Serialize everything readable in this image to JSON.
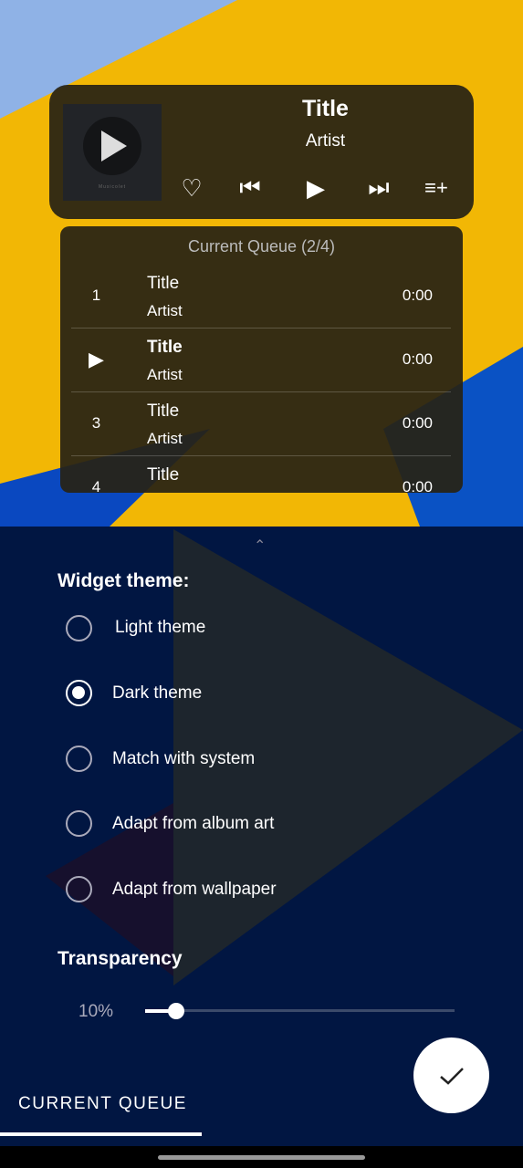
{
  "widget": {
    "album_art_label": "Musicolet",
    "title": "Title",
    "artist": "Artist",
    "icons": [
      "heart-icon",
      "skip-previous-icon",
      "play-icon",
      "skip-next-icon",
      "playlist-add-icon"
    ]
  },
  "queue": {
    "header": "Current Queue (2/4)",
    "items": [
      {
        "index": "1",
        "title": "Title",
        "artist": "Artist",
        "duration": "0:00",
        "playing": false
      },
      {
        "index": "",
        "title": "Title",
        "artist": "Artist",
        "duration": "0:00",
        "playing": true
      },
      {
        "index": "3",
        "title": "Title",
        "artist": "Artist",
        "duration": "0:00",
        "playing": false
      },
      {
        "index": "4",
        "title": "Title",
        "artist": "",
        "duration": "0:00",
        "playing": false
      }
    ]
  },
  "settings": {
    "theme_heading": "Widget theme:",
    "themes": [
      {
        "label": "Light theme",
        "selected": false
      },
      {
        "label": "Dark theme",
        "selected": true
      },
      {
        "label": "Match with system",
        "selected": false
      },
      {
        "label": "Adapt from album art",
        "selected": false
      },
      {
        "label": "Adapt from wallpaper",
        "selected": false
      }
    ],
    "transparency_heading": "Transparency",
    "transparency_value": "10%",
    "transparency_percent": 10
  },
  "tabs": {
    "current_queue": "CURRENT QUEUE"
  },
  "colors": {
    "wallpaper_yellow": "#f2b705",
    "wallpaper_blue": "#0a52c4",
    "sheet": "#001032"
  }
}
